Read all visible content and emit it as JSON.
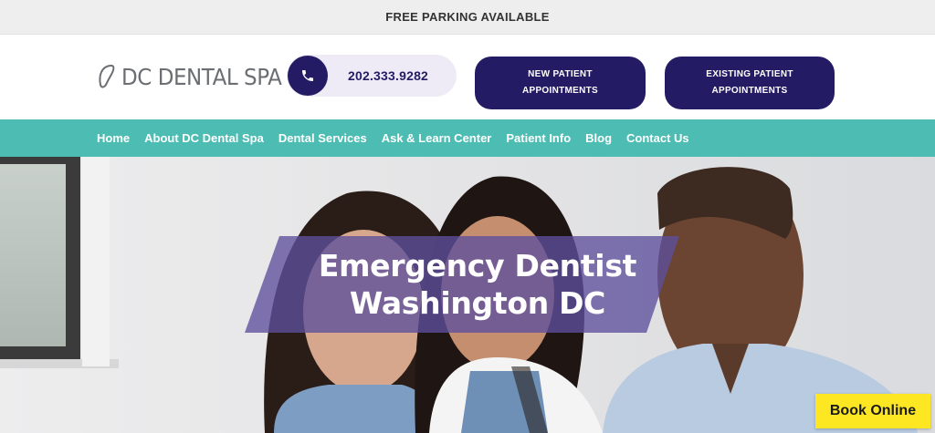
{
  "announcement": {
    "text": "FREE PARKING AVAILABLE"
  },
  "header": {
    "logo_text": "DC DENTAL SPA",
    "phone": {
      "icon": "phone-icon",
      "number": "202.333.9282"
    },
    "cta_new": {
      "line1": "NEW PATIENT",
      "line2": "APPOINTMENTS"
    },
    "cta_existing": {
      "line1": "EXISTING PATIENT",
      "line2": "APPOINTMENTS"
    }
  },
  "nav": {
    "items": [
      {
        "label": "Home"
      },
      {
        "label": "About DC Dental Spa"
      },
      {
        "label": "Dental Services"
      },
      {
        "label": "Ask & Learn Center"
      },
      {
        "label": "Patient Info"
      },
      {
        "label": "Blog"
      },
      {
        "label": "Contact Us"
      }
    ]
  },
  "hero": {
    "title_line1": "Emergency Dentist",
    "title_line2": "Washington DC"
  },
  "book_online": {
    "label": "Book Online"
  },
  "colors": {
    "brand_navy": "#231c64",
    "nav_teal": "#4dbdb3",
    "banner_purple": "#5d4f9c",
    "book_yellow": "#fde723"
  }
}
